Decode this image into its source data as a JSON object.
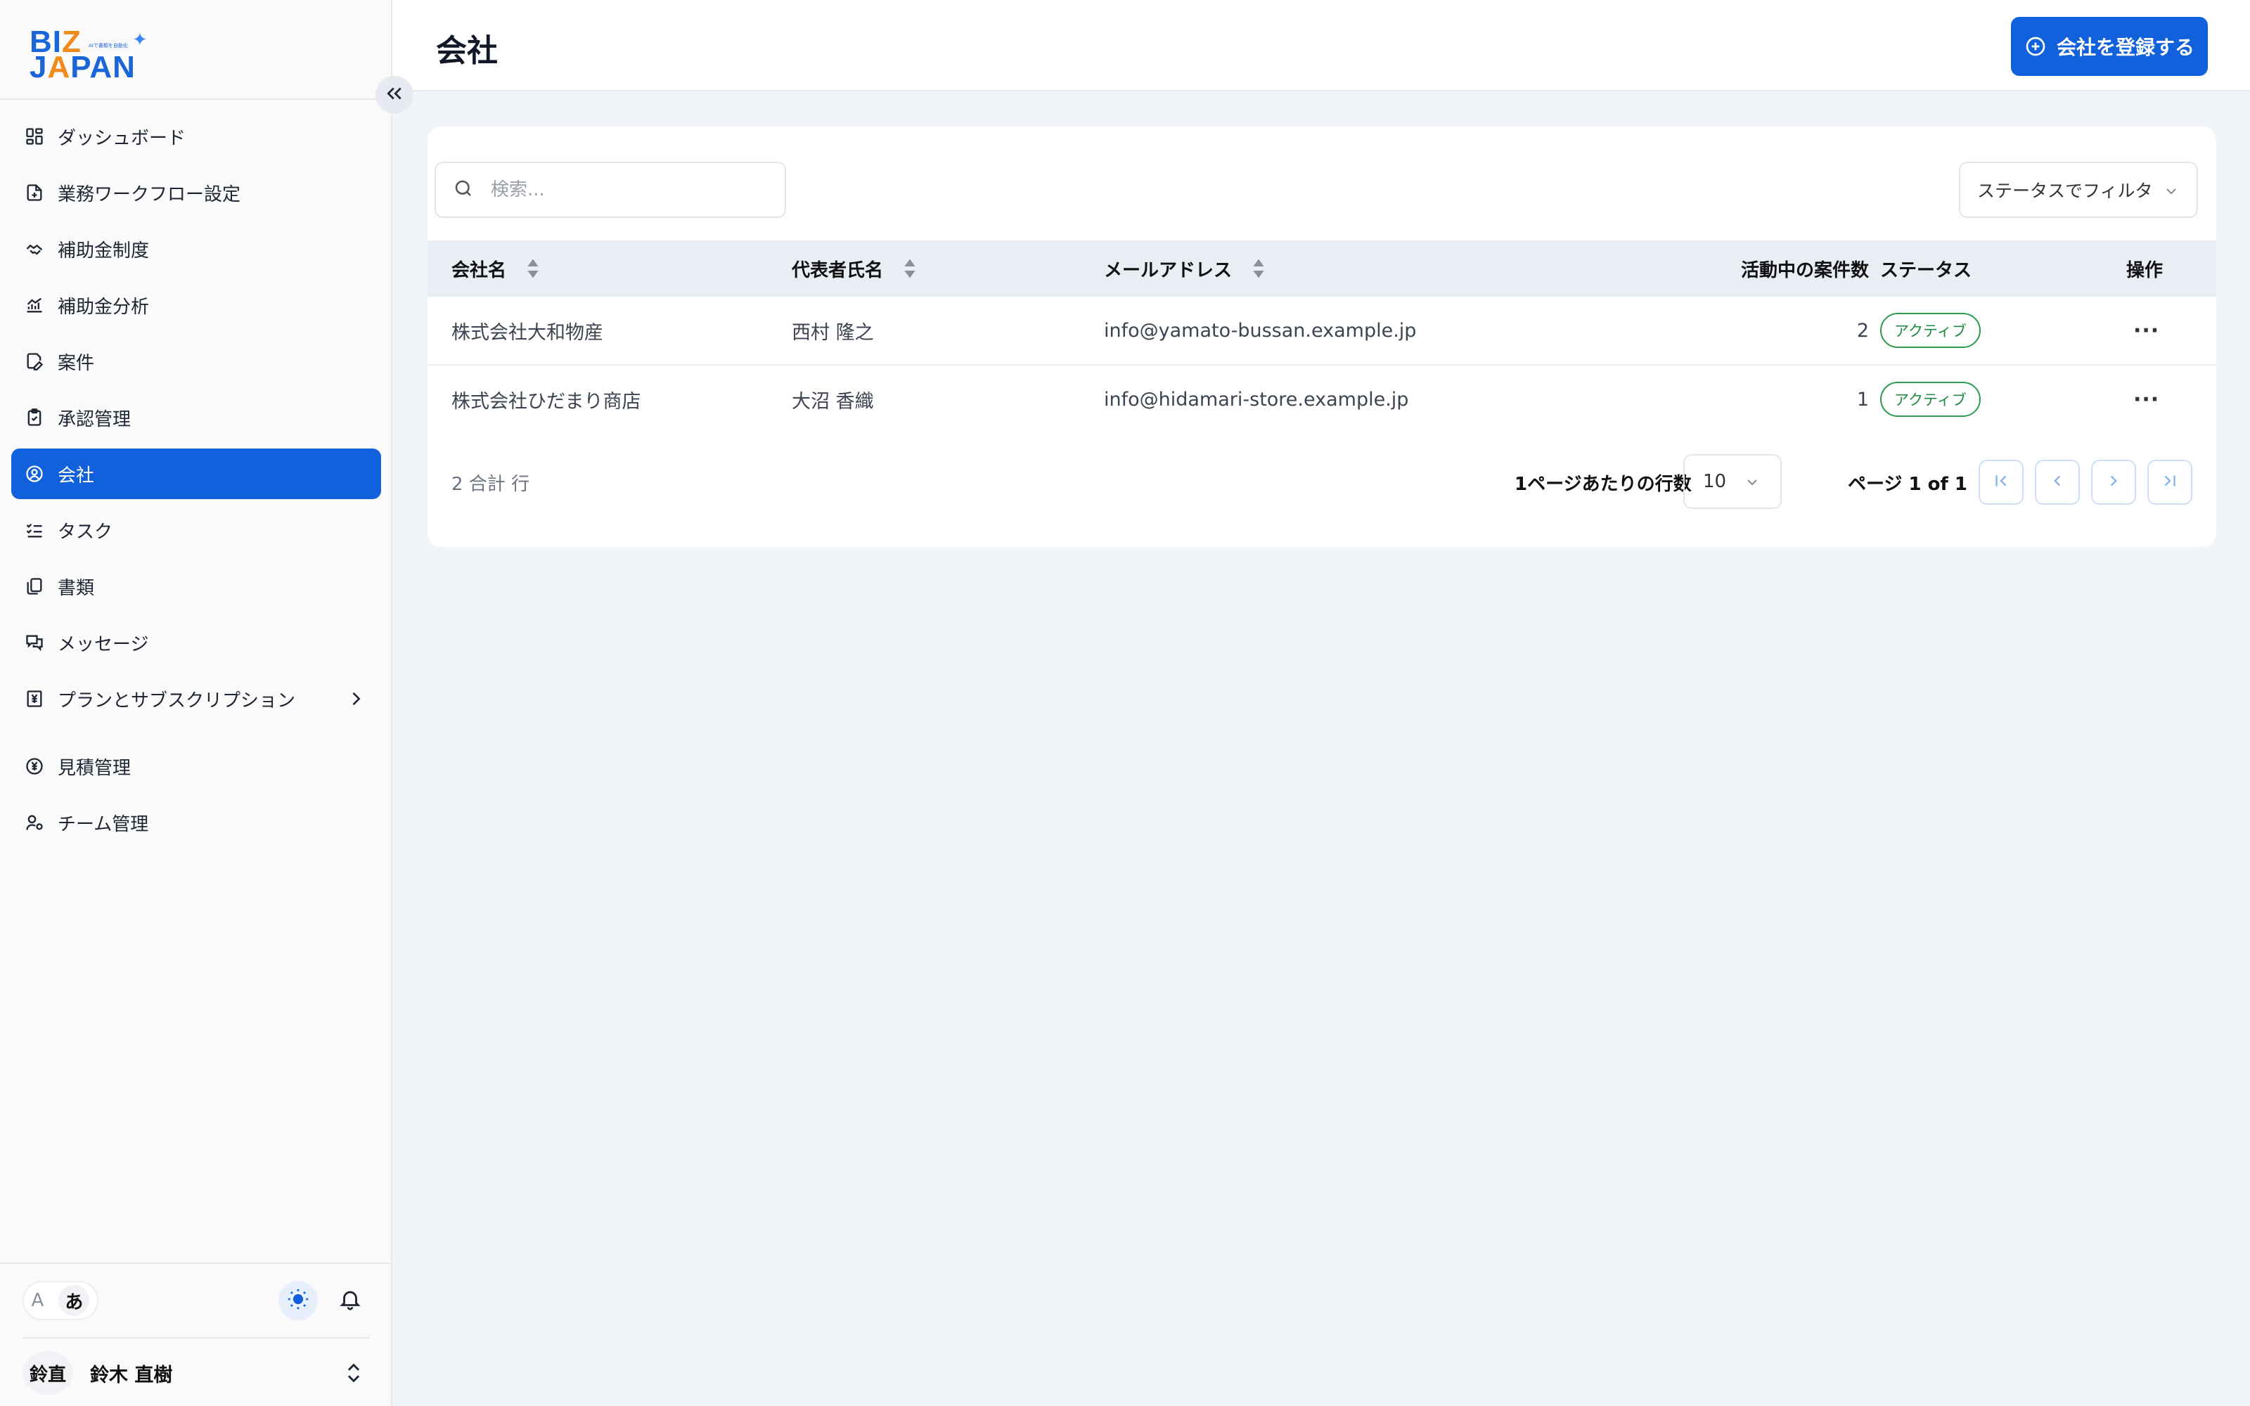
{
  "logo": {
    "line1_a": "BI",
    "line1_b": "Z",
    "line2_a": "J",
    "line2_b": "A",
    "line2_c": "PAN",
    "tagline": "AIで書類を自動化",
    "colors": {
      "primary": "#1a66d9",
      "accent": "#f08a1a"
    }
  },
  "sidebar": {
    "items": [
      {
        "label": "ダッシュボード",
        "icon": "dashboard-icon"
      },
      {
        "label": "業務ワークフロー設定",
        "icon": "workflow-icon"
      },
      {
        "label": "補助金制度",
        "icon": "handshake-icon"
      },
      {
        "label": "補助金分析",
        "icon": "chart-icon"
      },
      {
        "label": "案件",
        "icon": "edit-doc-icon"
      },
      {
        "label": "承認管理",
        "icon": "clipboard-check-icon"
      },
      {
        "label": "会社",
        "icon": "user-circle-icon",
        "active": true
      },
      {
        "label": "タスク",
        "icon": "list-check-icon"
      },
      {
        "label": "書類",
        "icon": "files-icon"
      },
      {
        "label": "メッセージ",
        "icon": "messages-icon"
      },
      {
        "label": "プランとサブスクリプション",
        "icon": "yen-receipt-icon",
        "has_submenu": true
      },
      {
        "label": "見積管理",
        "icon": "yen-circle-icon"
      },
      {
        "label": "チーム管理",
        "icon": "user-settings-icon"
      }
    ],
    "lang": {
      "en": "A",
      "ja": "あ"
    },
    "user": {
      "initials": "鈴直",
      "name": "鈴木 直樹"
    }
  },
  "header": {
    "title": "会社",
    "register_label": "会社を登録する",
    "accent": "#1160dc"
  },
  "toolbar": {
    "search_placeholder": "検索...",
    "status_filter": "ステータスでフィルタ"
  },
  "table": {
    "columns": [
      "会社名",
      "代表者氏名",
      "メールアドレス",
      "活動中の案件数",
      "ステータス",
      "操作"
    ],
    "rows": [
      {
        "company": "株式会社大和物産",
        "representative": "西村 隆之",
        "email": "info@yamato-bussan.example.jp",
        "active_cases": "2",
        "status": "アクティブ",
        "actions": "···"
      },
      {
        "company": "株式会社ひだまり商店",
        "representative": "大沼 香織",
        "email": "info@hidamari-store.example.jp",
        "active_cases": "1",
        "status": "アクティブ",
        "actions": "···"
      }
    ]
  },
  "pagination": {
    "total": "2 合計 行",
    "rows_per_page_label": "1ページあたりの行数",
    "rows_per_page": "10",
    "page_info": "ページ 1 of 1"
  }
}
